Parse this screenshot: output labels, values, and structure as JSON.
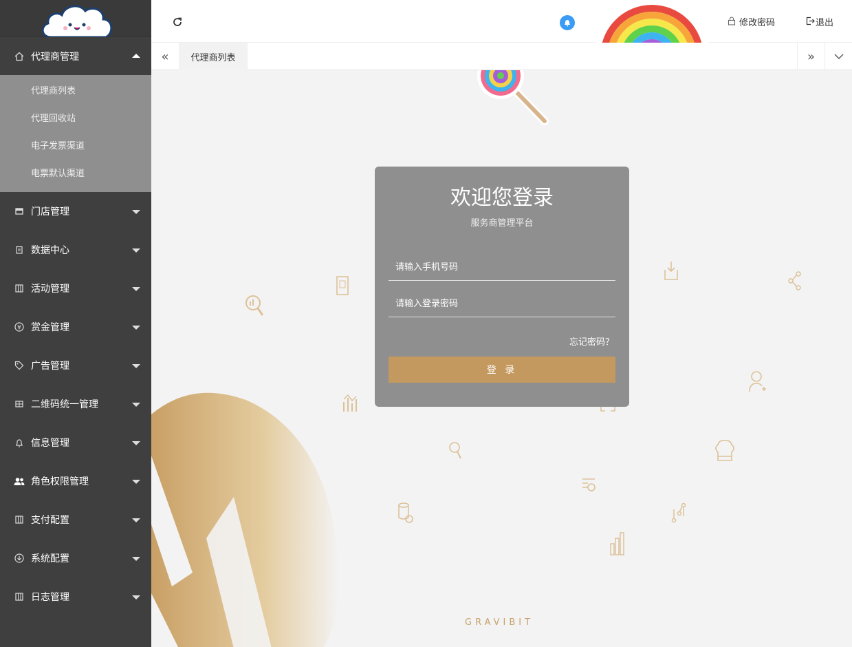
{
  "sidebar": {
    "groups": [
      {
        "label": "代理商管理",
        "icon": "home-icon",
        "expanded": true,
        "items": [
          {
            "label": "代理商列表"
          },
          {
            "label": "代理回收站"
          },
          {
            "label": "电子发票渠道"
          },
          {
            "label": "电票默认渠道"
          }
        ]
      },
      {
        "label": "门店管理",
        "icon": "store-icon"
      },
      {
        "label": "数据中心",
        "icon": "clipboard-icon"
      },
      {
        "label": "活动管理",
        "icon": "grid-icon"
      },
      {
        "label": "赏金管理",
        "icon": "yen-icon"
      },
      {
        "label": "广告管理",
        "icon": "tag-icon"
      },
      {
        "label": "二维码统一管理",
        "icon": "qrcode-icon"
      },
      {
        "label": "信息管理",
        "icon": "bell-icon"
      },
      {
        "label": "角色权限管理",
        "icon": "users-icon"
      },
      {
        "label": "支付配置",
        "icon": "grid-icon"
      },
      {
        "label": "系统配置",
        "icon": "download-icon"
      },
      {
        "label": "日志管理",
        "icon": "grid-icon"
      }
    ]
  },
  "header": {
    "change_password": "修改密码",
    "logout": "退出"
  },
  "tabs": {
    "active": "代理商列表"
  },
  "login": {
    "title": "欢迎您登录",
    "subtitle": "服务商管理平台",
    "phone_placeholder": "请输入手机号码",
    "password_placeholder": "请输入登录密码",
    "forgot": "忘记密码？",
    "submit": "登 录"
  },
  "background": {
    "brand": "GRAVIBIT"
  },
  "colors": {
    "sidebar": "#3f3f3f",
    "submenu": "#8f8f8f",
    "accent": "#c4995f",
    "bell": "#3b9cf5"
  }
}
